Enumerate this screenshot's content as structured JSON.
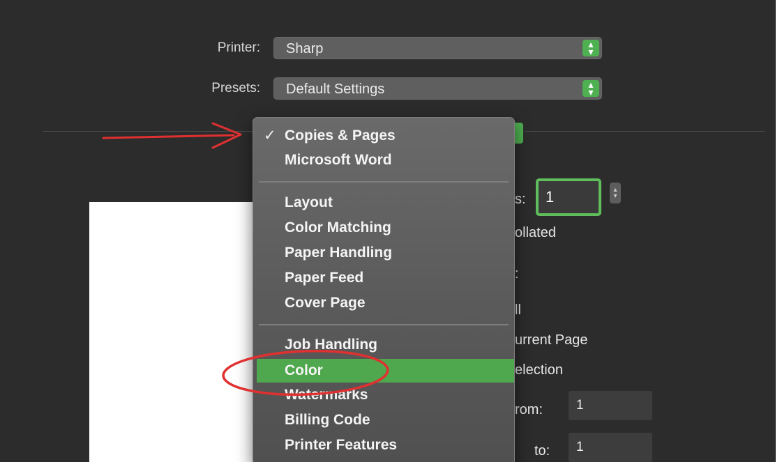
{
  "printer": {
    "label": "Printer:",
    "value": "Sharp"
  },
  "presets": {
    "label": "Presets:",
    "value": "Default Settings"
  },
  "stepper_arrows": {
    "up": "▴",
    "down": "▾"
  },
  "menu": {
    "groups": [
      {
        "items": [
          {
            "label": "Copies & Pages",
            "checked": true,
            "check_mark": "✓"
          },
          {
            "label": "Microsoft Word"
          }
        ]
      },
      {
        "items": [
          {
            "label": "Layout"
          },
          {
            "label": "Color Matching"
          },
          {
            "label": "Paper Handling"
          },
          {
            "label": "Paper Feed"
          },
          {
            "label": "Cover Page"
          }
        ]
      },
      {
        "items": [
          {
            "label": "Job Handling"
          },
          {
            "label": "Color",
            "highlighted": true
          },
          {
            "label": "Watermarks"
          },
          {
            "label": "Billing Code"
          },
          {
            "label": "Printer Features"
          }
        ]
      }
    ]
  },
  "right_panel": {
    "copies_label_partial": "s:",
    "copies_value": "1",
    "collated_partial": "ollated",
    "pages_label_partial": ":",
    "option_all": "ll",
    "option_current": "urrent Page",
    "option_selection": "election",
    "from_label": "rom:",
    "from_value": "1",
    "to_label": "to:",
    "to_value": "1"
  },
  "colors": {
    "accent_green": "#4fb052",
    "annotation_red": "#e03030"
  }
}
